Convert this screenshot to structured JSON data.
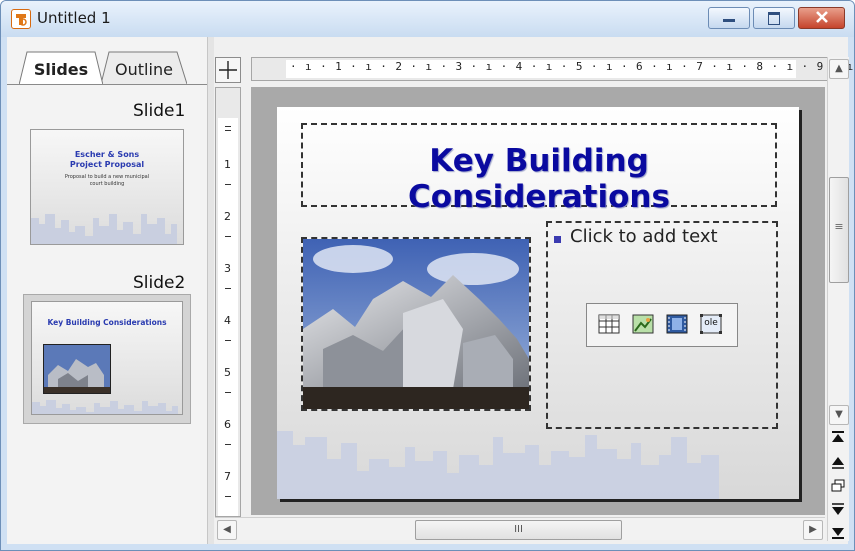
{
  "window": {
    "title": "Untitled 1",
    "icon": "impress-app-icon",
    "controls": {
      "minimize": "minimize-icon",
      "maximize": "maximize-icon",
      "close": "close-icon"
    }
  },
  "left_pane": {
    "tabs": [
      {
        "label": "Slides",
        "active": true
      },
      {
        "label": "Outline",
        "active": false
      }
    ],
    "slides": [
      {
        "label": "Slide1",
        "title_line1": "Escher & Sons",
        "title_line2": "Project Proposal",
        "subtitle_line1": "Proposal to build a new municipal",
        "subtitle_line2": "court building"
      },
      {
        "label": "Slide2",
        "title": "Key Building Considerations",
        "selected": true
      }
    ]
  },
  "ruler": {
    "horizontal": "· ı · 1 · ı · 2 · ı · 3 · ı · 4 · ı · 5 · ı · 6 · ı · 7 · ı · 8 · ı · 9 · ı ·",
    "vertical_numbers": [
      "1",
      "2",
      "3",
      "4",
      "5",
      "6",
      "7"
    ]
  },
  "slide": {
    "title": "Key Building Considerations",
    "body_placeholder": "Click to add text",
    "insert_icons": [
      "insert-table-icon",
      "insert-chart-icon",
      "insert-movie-icon",
      "insert-ole-object-icon"
    ],
    "ole_label": "ole"
  },
  "scrollbars": {
    "nav_icons": [
      "first-slide-icon",
      "previous-slide-icon",
      "slide-sorter-icon",
      "next-slide-icon",
      "last-slide-icon"
    ],
    "hthumb_grip": "III",
    "vthumb_grip": "≡"
  },
  "colors": {
    "title_blue": "#0a0aa0",
    "close_red": "#c5442c",
    "canvas_gray": "#a9a9a9"
  }
}
